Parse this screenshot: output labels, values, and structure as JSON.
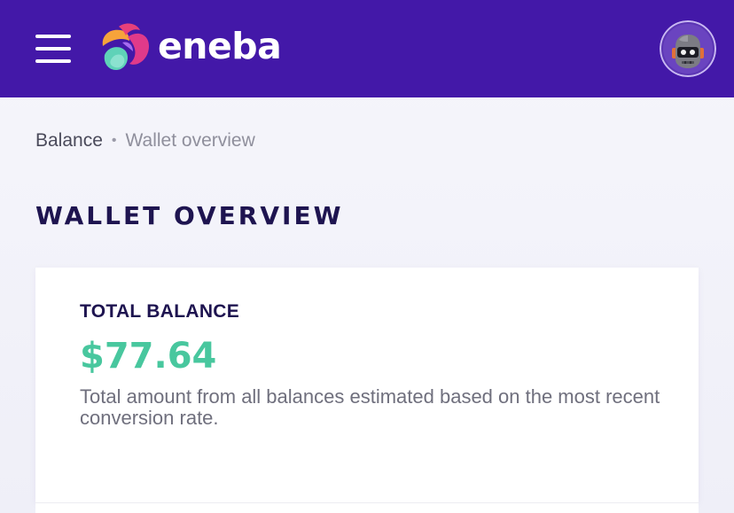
{
  "header": {
    "menu_icon": "hamburger-menu-icon",
    "logo_text": "eneba",
    "logo_icon": "eneba-logo-icon",
    "avatar_icon": "robot-avatar-icon",
    "colors": {
      "header_bg": "#4318a8",
      "logo_text": "#ffffff"
    }
  },
  "breadcrumb": {
    "parent": "Balance",
    "separator": "•",
    "current": "Wallet overview"
  },
  "page": {
    "title": "WALLET OVERVIEW"
  },
  "balance_card": {
    "label": "TOTAL BALANCE",
    "amount": "$77.64",
    "description": "Total amount from all balances estimated based on the most recent conversion rate.",
    "colors": {
      "amount": "#48c79e",
      "label": "#1e1450"
    }
  }
}
